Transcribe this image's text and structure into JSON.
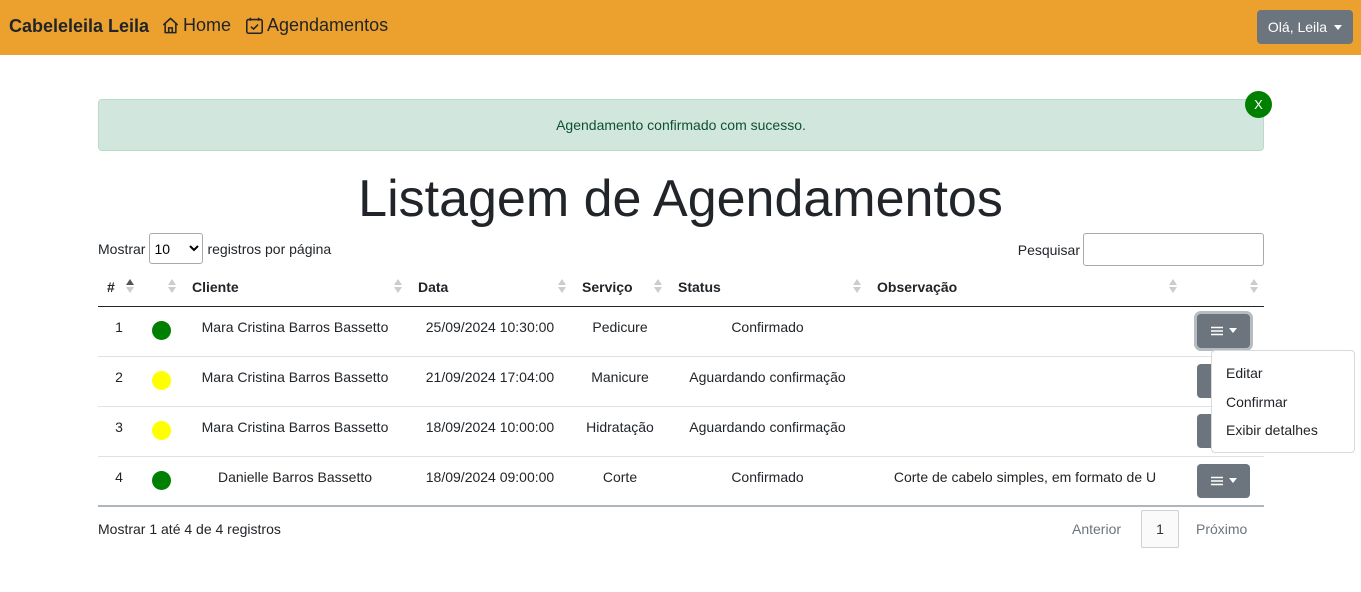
{
  "navbar": {
    "brand": "Cabeleleila Leila",
    "links": [
      {
        "label": "Home",
        "icon": "home-icon"
      },
      {
        "label": "Agendamentos",
        "icon": "calendar-check-icon"
      }
    ],
    "user_menu": "Olá, Leila"
  },
  "alert": {
    "message": "Agendamento confirmado com sucesso.",
    "close_label": "X"
  },
  "page_title": "Listagem de Agendamentos",
  "length_menu": {
    "prefix": "Mostrar",
    "value": "10",
    "suffix": "registros por página"
  },
  "search": {
    "label": "Pesquisar",
    "value": ""
  },
  "table": {
    "headers": [
      "#",
      "",
      "Cliente",
      "Data",
      "Serviço",
      "Status",
      "Observação",
      ""
    ],
    "rows": [
      {
        "id": "1",
        "status_color": "#008000",
        "cliente": "Mara Cristina Barros Bassetto",
        "data": "25/09/2024 10:30:00",
        "servico": "Pedicure",
        "status": "Confirmado",
        "observacao": ""
      },
      {
        "id": "2",
        "status_color": "#ffff00",
        "cliente": "Mara Cristina Barros Bassetto",
        "data": "21/09/2024 17:04:00",
        "servico": "Manicure",
        "status": "Aguardando confirmação",
        "observacao": ""
      },
      {
        "id": "3",
        "status_color": "#ffff00",
        "cliente": "Mara Cristina Barros Bassetto",
        "data": "18/09/2024 10:00:00",
        "servico": "Hidratação",
        "status": "Aguardando confirmação",
        "observacao": ""
      },
      {
        "id": "4",
        "status_color": "#008000",
        "cliente": "Danielle Barros Bassetto",
        "data": "18/09/2024 09:00:00",
        "servico": "Corte",
        "status": "Confirmado",
        "observacao": "Corte de cabelo simples, em formato de U"
      }
    ]
  },
  "dropdown": {
    "items": [
      "Editar",
      "Confirmar",
      "Exibir detalhes"
    ]
  },
  "footer": {
    "info": "Mostrar 1 até 4 de 4 registros",
    "previous": "Anterior",
    "page": "1",
    "next": "Próximo"
  },
  "colors": {
    "navbar": "#eca12e",
    "alert_bg": "#d1e7dd",
    "confirmed": "#008000",
    "pending": "#ffff00",
    "button": "#6c757d"
  }
}
